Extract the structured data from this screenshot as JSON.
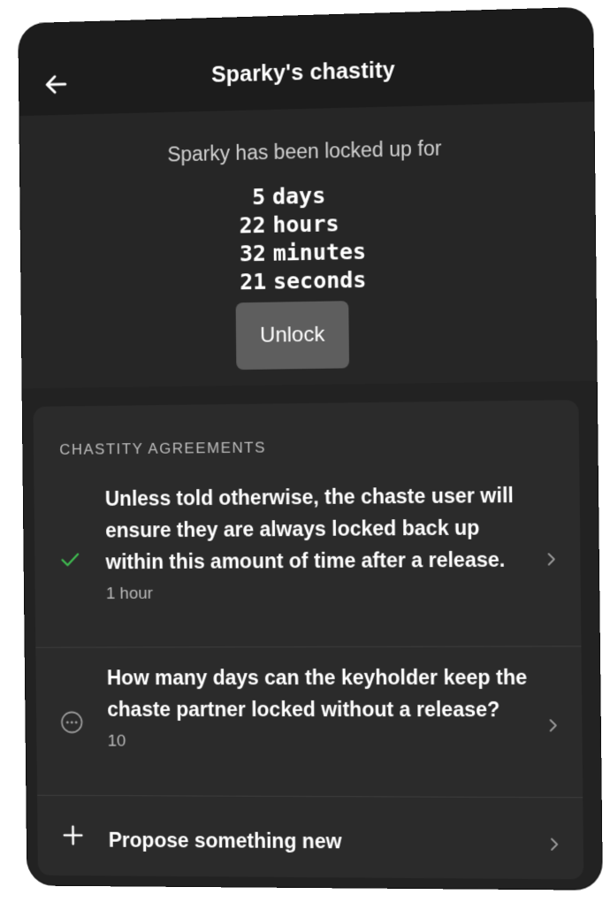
{
  "header": {
    "title": "Sparky's chastity",
    "back_icon": "arrow-left-icon"
  },
  "lock_status": {
    "caption": "Sparky has been locked up for",
    "timer": [
      {
        "value": "5",
        "unit": "days"
      },
      {
        "value": "22",
        "unit": "hours"
      },
      {
        "value": "32",
        "unit": "minutes"
      },
      {
        "value": "21",
        "unit": "seconds"
      }
    ],
    "unlock_label": "Unlock"
  },
  "agreements": {
    "section_title": "CHASTITY AGREEMENTS",
    "items": [
      {
        "icon": "check-icon",
        "icon_color": "#3fb950",
        "question": "Unless told otherwise, the chaste user will ensure they are always locked back up within this amount of time after a release.",
        "value": "1 hour"
      },
      {
        "icon": "pending-dots-icon",
        "icon_color": "#9a9a9a",
        "question": "How many days can the keyholder keep the chaste partner locked without a release?",
        "value": "10"
      }
    ],
    "propose_icon": "plus-icon",
    "propose_label": "Propose something new"
  },
  "colors": {
    "header_bg": "#1c1c1c",
    "panel_bg": "#262626",
    "card_bg": "#2b2b2b",
    "button_bg": "#5e5e5e"
  }
}
